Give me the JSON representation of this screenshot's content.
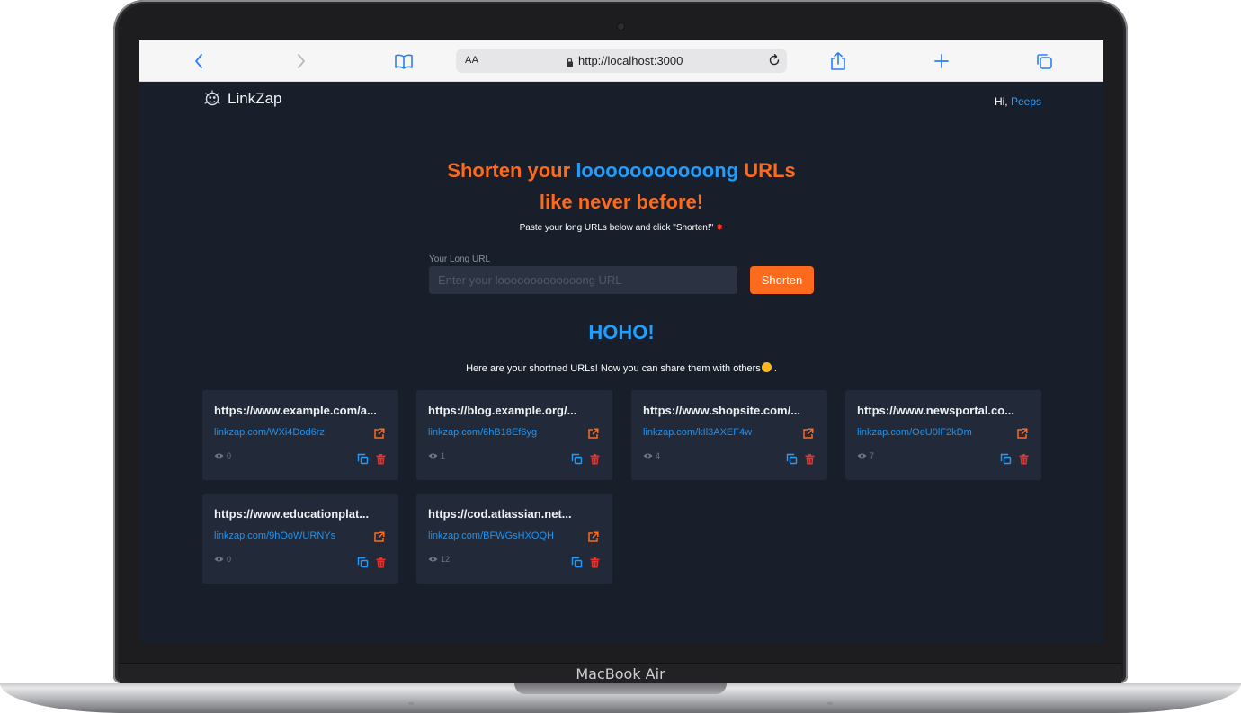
{
  "device": {
    "label": "MacBook Air"
  },
  "browser": {
    "aa_label": "AA",
    "url": "http://localhost:3000",
    "icons": [
      "chevron-left-icon",
      "chevron-right-icon",
      "book-icon",
      "lock-icon",
      "reload-icon",
      "share-icon",
      "plus-icon",
      "tabs-icon"
    ]
  },
  "nav": {
    "brand": "LinkZap",
    "greeting_prefix": "Hi,",
    "user": "Peeps"
  },
  "hero": {
    "title_part1": "Shorten your",
    "title_highlight": "looooooooooong",
    "title_part2": "URLs",
    "title_line2": "like never before!",
    "subtitle": "Paste your long URLs below and click \"Shorten!\""
  },
  "form": {
    "label": "Your Long URL",
    "placeholder": "Enter your looooooooooooong URL",
    "value": "",
    "button": "Shorten"
  },
  "results": {
    "heading": "HOHO!",
    "subheading": "Here are your shortned URLs! Now you can share them with others",
    "subheading_end": "."
  },
  "links": [
    {
      "long": "https://www.example.com/a...",
      "short": "linkzap.com/WXi4Dod6rz",
      "views": "0"
    },
    {
      "long": "https://blog.example.org/...",
      "short": "linkzap.com/6hB18Ef6yg",
      "views": "1"
    },
    {
      "long": "https://www.shopsite.com/...",
      "short": "linkzap.com/kIl3AXEF4w",
      "views": "4"
    },
    {
      "long": "https://www.newsportal.co...",
      "short": "linkzap.com/OeU0lF2kDm",
      "views": "7"
    },
    {
      "long": "https://www.educationplat...",
      "short": "linkzap.com/9hOoWURNYs",
      "views": "0"
    },
    {
      "long": "https://cod.atlassian.net...",
      "short": "linkzap.com/BFWGsHXOQH",
      "views": "12"
    }
  ],
  "colors": {
    "background": "#181e2a",
    "card": "#222a39",
    "accent_orange": "#fb6a1d",
    "accent_blue": "#1f9eff",
    "delete_red": "#e5322b"
  }
}
